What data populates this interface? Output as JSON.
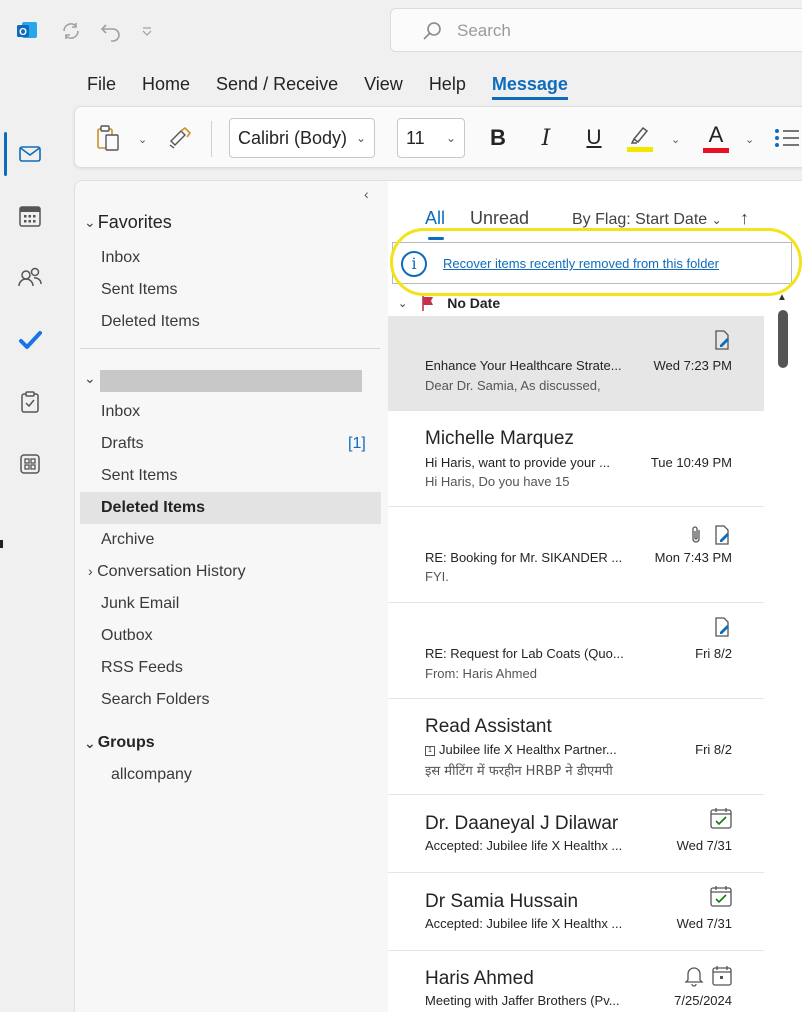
{
  "titlebar": {
    "search_placeholder": "Search",
    "outlook_logo_letter": "O"
  },
  "menu": [
    {
      "label": "File"
    },
    {
      "label": "Home"
    },
    {
      "label": "Send / Receive"
    },
    {
      "label": "View"
    },
    {
      "label": "Help"
    },
    {
      "label": "Message",
      "active": true
    }
  ],
  "ribbon": {
    "font_name": "Calibri (Body)",
    "font_size": "11",
    "bold_label": "B",
    "italic_label": "I",
    "underline_label": "U",
    "font_color_label": "A",
    "highlight_color": "#f5e600",
    "font_color": "#e81123"
  },
  "folders": {
    "favorites_label": "Favorites",
    "favorites": [
      {
        "label": "Inbox"
      },
      {
        "label": "Sent Items"
      },
      {
        "label": "Deleted Items"
      }
    ],
    "account_items": [
      {
        "label": "Inbox",
        "count": ""
      },
      {
        "label": "Drafts",
        "count": "[1]"
      },
      {
        "label": "Sent Items",
        "count": ""
      },
      {
        "label": "Deleted Items",
        "count": "",
        "selected": true
      },
      {
        "label": "Archive",
        "count": ""
      },
      {
        "label": "Conversation History",
        "count": "",
        "expandable": true
      },
      {
        "label": "Junk Email",
        "count": ""
      },
      {
        "label": "Outbox",
        "count": ""
      },
      {
        "label": "RSS Feeds",
        "count": ""
      },
      {
        "label": "Search Folders",
        "count": ""
      }
    ],
    "groups_label": "Groups",
    "groups": [
      {
        "label": "allcompany"
      }
    ]
  },
  "list": {
    "tab_all": "All",
    "tab_unread": "Unread",
    "sort_label": "By Flag: Start Date",
    "sort_arrow": "↑",
    "info_text": "Recover items recently removed from this folder",
    "group_header": "No Date",
    "accent": "#0f6cbd",
    "highlight_ring_color": "#f2e31a",
    "messages": [
      {
        "sender": "",
        "subject": "Enhance Your Healthcare Strate...",
        "preview": "Dear Dr. Samia,  As discussed,",
        "time": "Wed 7:23 PM",
        "icons": [
          "draft-icon"
        ],
        "selected": true
      },
      {
        "sender": "Michelle Marquez",
        "subject": "Hi Haris, want to provide your ...",
        "preview": "Hi Haris,  Do you have 15",
        "time": "Tue 10:49 PM",
        "icons": []
      },
      {
        "sender": "",
        "subject": "RE: Booking for Mr. SIKANDER ...",
        "preview": "FYI.",
        "time": "Mon 7:43 PM",
        "icons": [
          "paperclip-icon",
          "draft-icon"
        ]
      },
      {
        "sender": "",
        "subject": "RE: Request for Lab Coats (Quo...",
        "preview": "From: Haris Ahmed",
        "time": "Fri 8/2",
        "icons": [
          "draft-icon"
        ]
      },
      {
        "sender": "Read Assistant",
        "subject": "Jubilee life X Healthx Partner...",
        "preview": "इस मीटिंग में फरहीन HRBP ने डीएमपी",
        "time": "Fri 8/2",
        "icons": []
      },
      {
        "sender": "Dr. Daaneyal J Dilawar",
        "subject": "Accepted: Jubilee life X Healthx ...",
        "preview": "",
        "time": "Wed 7/31",
        "icons": [
          "calendar-check-icon"
        ]
      },
      {
        "sender": "Dr Samia Hussain",
        "subject": "Accepted: Jubilee life X Healthx ...",
        "preview": "",
        "time": "Wed 7/31",
        "icons": [
          "calendar-check-icon"
        ]
      },
      {
        "sender": "Haris Ahmed",
        "subject": "Meeting with Jaffer Brothers (Pv...",
        "preview": "",
        "time": "7/25/2024",
        "icons": [
          "bell-icon",
          "calendar-icon"
        ]
      }
    ]
  }
}
